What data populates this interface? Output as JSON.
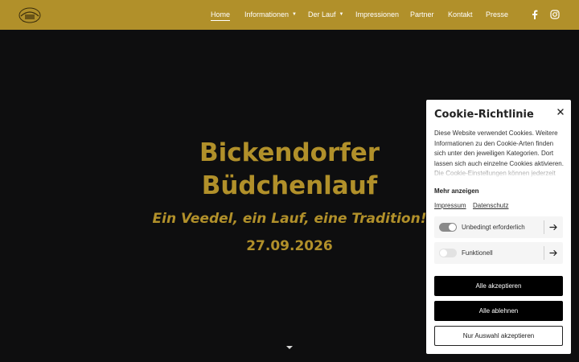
{
  "colors": {
    "brand": "#b1902a",
    "background": "#0e0e0f",
    "toggle_on": "#8a8a8a",
    "toggle_off": "#e2e2e2"
  },
  "header": {
    "logo_icon": "club-logo",
    "nav": [
      {
        "label": "Home",
        "active": true
      },
      {
        "label": "Informationen",
        "dropdown": true
      },
      {
        "label": "Der Lauf",
        "dropdown": true
      },
      {
        "label": "Impressionen"
      },
      {
        "label": "Partner"
      },
      {
        "label": "Kontakt"
      },
      {
        "label": "Presse"
      }
    ],
    "social": [
      "facebook-icon",
      "instagram-icon"
    ]
  },
  "hero": {
    "title_line1": "Bickendorfer",
    "title_line2": "Büdchenlauf",
    "subtitle": "Ein Veedel, ein Lauf, eine Tradition!",
    "date": "27.09.2026",
    "scroll_icon": "chevron-down-icon"
  },
  "cookie": {
    "title": "Cookie-Richtlinie",
    "close_icon": "close-icon",
    "text": "Diese Website verwendet Cookies. Weitere Informationen zu den Cookie-Arten finden sich unter den jeweiligen Kategorien. Dort lassen sich auch einzelne Cookies aktivieren. Die Cookie-Einstellungen können jederzeit",
    "more": "Mehr anzeigen",
    "links": [
      "Impressum",
      "Datenschutz"
    ],
    "categories": [
      {
        "label": "Unbedingt erforderlich",
        "enabled": true
      },
      {
        "label": "Funktionell",
        "enabled": false
      }
    ],
    "accept_all": "Alle akzeptieren",
    "reject_all": "Alle ablehnen",
    "accept_selection": "Nur Auswahl akzeptieren"
  }
}
